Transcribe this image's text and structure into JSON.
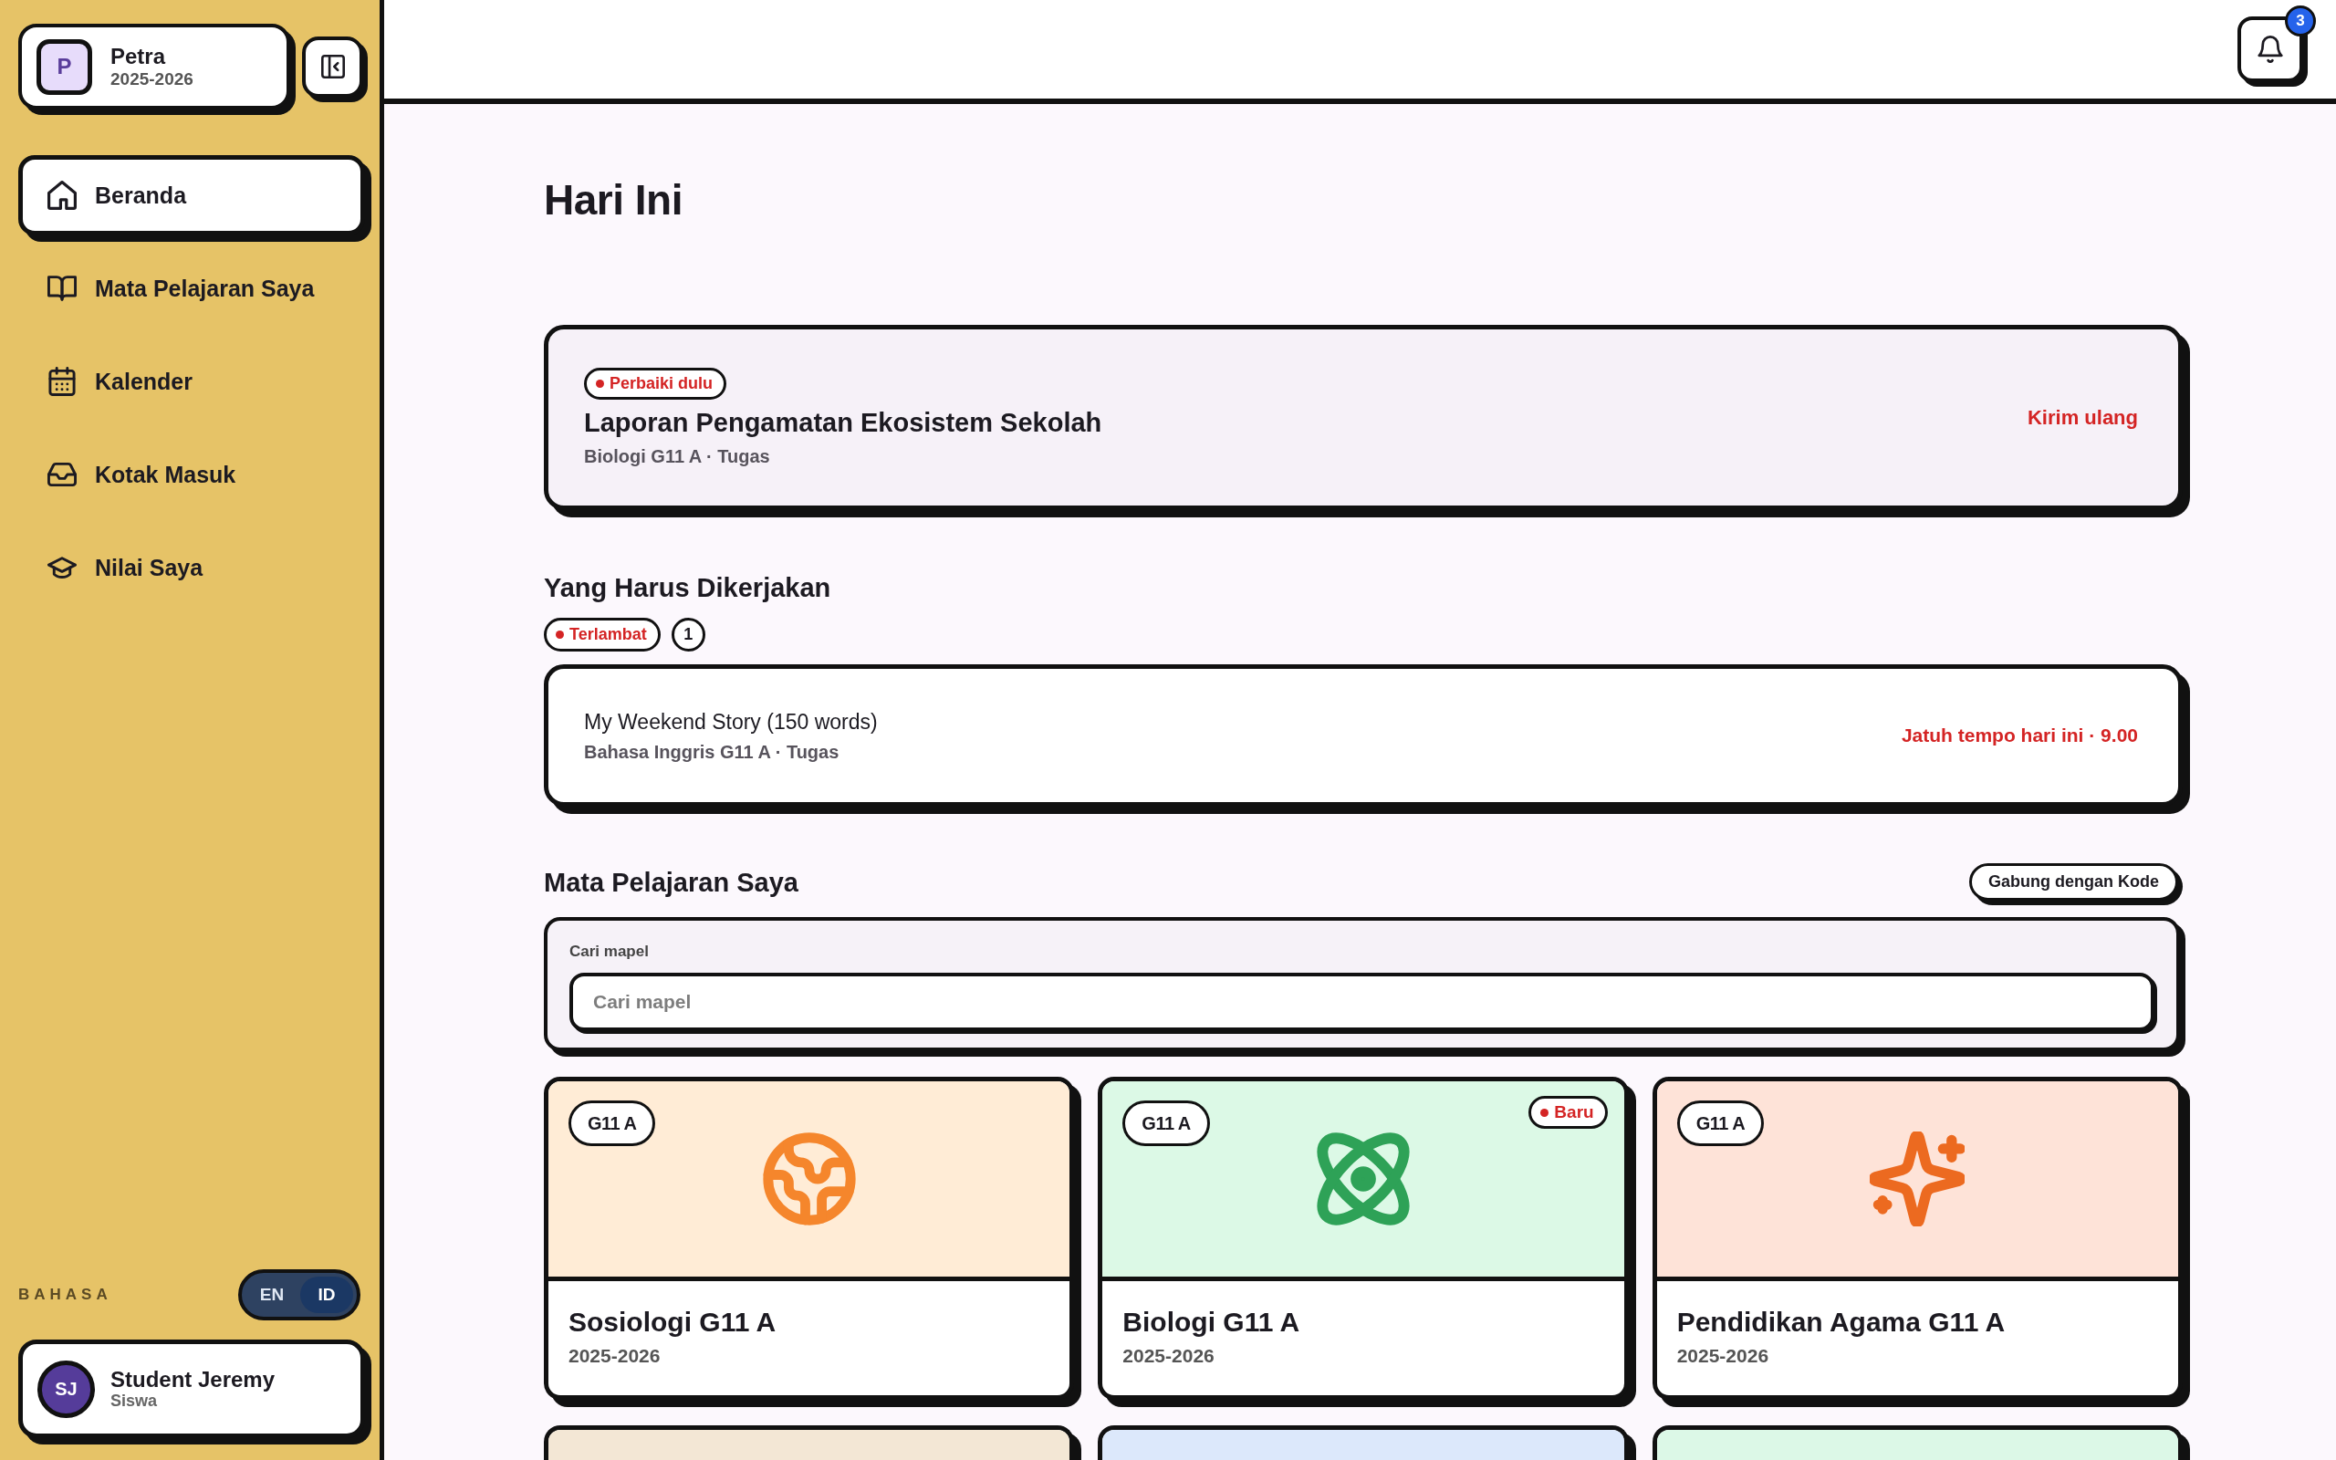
{
  "workspace": {
    "avatar": "P",
    "name": "Petra",
    "year": "2025-2026"
  },
  "sidebar": {
    "items": [
      {
        "kind": "home",
        "label": "Beranda",
        "selected": true
      },
      {
        "kind": "courses",
        "label": "Mata Pelajaran Saya",
        "selected": false
      },
      {
        "kind": "calendar",
        "label": "Kalender",
        "selected": false
      },
      {
        "kind": "inbox",
        "label": "Kotak Masuk",
        "selected": false
      },
      {
        "kind": "grades",
        "label": "Nilai Saya",
        "selected": false
      }
    ]
  },
  "language": {
    "label": "BAHASA",
    "options": [
      {
        "label": "EN",
        "selected": false
      },
      {
        "label": "ID",
        "selected": true
      }
    ]
  },
  "user": {
    "initials": "SJ",
    "name": "Student Jeremy",
    "role": "Siswa"
  },
  "header": {
    "notification_count": "3"
  },
  "page_title": "Hari Ini",
  "fix_card": {
    "badge": "Perbaiki dulu",
    "title": "Laporan Pengamatan Ekosistem Sekolah",
    "meta": "Biologi G11 A · Tugas",
    "action": "Kirim ulang"
  },
  "todo": {
    "heading": "Yang Harus Dikerjakan",
    "filter": "Terlambat",
    "count": "1",
    "items": [
      {
        "title": "My Weekend Story (150 words)",
        "meta": "Bahasa Inggris G11 A · Tugas",
        "due": "Jatuh tempo hari ini · 9.00"
      }
    ]
  },
  "subjects": {
    "heading": "Mata Pelajaran Saya",
    "join_button": "Gabung dengan Kode",
    "search": {
      "label": "Cari mapel",
      "placeholder": "Cari mapel"
    },
    "cards": [
      {
        "kind": "social",
        "color": "#ffecd6",
        "class": "G11 A",
        "title": "Sosiologi G11 A",
        "year": "2025-2026"
      },
      {
        "kind": "science",
        "color": "#dcf9e6",
        "class": "G11 A",
        "badge": "Baru",
        "title": "Biologi G11 A",
        "year": "2025-2026"
      },
      {
        "kind": "religion",
        "color": "#fee3d8",
        "class": "G11 A",
        "title": "Pendidikan Agama G11 A",
        "year": "2025-2026"
      },
      {
        "color": "#f3e7d5"
      },
      {
        "color": "#dce8fb"
      },
      {
        "color": "#dcf8e7"
      }
    ]
  }
}
